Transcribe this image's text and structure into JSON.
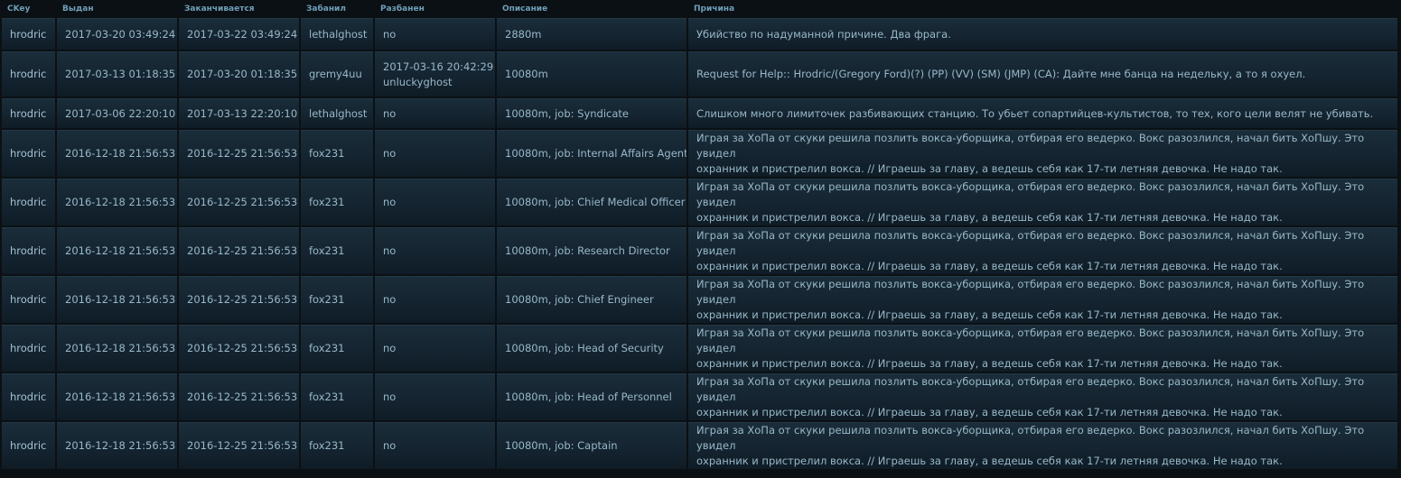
{
  "headers": {
    "ckey": "CKey",
    "issued": "Выдан",
    "expires": "Заканчивается",
    "banned_by": "Забанил",
    "unbanned": "Разбанен",
    "description": "Описание",
    "reason": "Причина"
  },
  "rows": [
    {
      "ckey": "hrodric",
      "issued": "2017-03-20 03:49:24",
      "expires": "2017-03-22 03:49:24",
      "banned_by": "lethalghost",
      "unbanned": "no",
      "unbanned_by": "",
      "description": "2880m",
      "reason_1": "Убийство по надуманной причине. Два фрага.",
      "reason_2": ""
    },
    {
      "ckey": "hrodric",
      "issued": "2017-03-13 01:18:35",
      "expires": "2017-03-20 01:18:35",
      "banned_by": "gremy4uu",
      "unbanned": "2017-03-16 20:42:29",
      "unbanned_by": "unluckyghost",
      "description": "10080m",
      "reason_1": "Request for Help:: Hrodric/(Gregory Ford)(?) (PP) (VV) (SM) (JMP) (CA): Дайте мне банца на недельку, а то я охуел.",
      "reason_2": ""
    },
    {
      "ckey": "hrodric",
      "issued": "2017-03-06 22:20:10",
      "expires": "2017-03-13 22:20:10",
      "banned_by": "lethalghost",
      "unbanned": "no",
      "unbanned_by": "",
      "description": "10080m, job: Syndicate",
      "reason_1": "Слишком много лимиточек разбивающих станцию. То убьет сопартийцев-культистов, то тех, кого цели велят не убивать.",
      "reason_2": ""
    },
    {
      "ckey": "hrodric",
      "issued": "2016-12-18 21:56:53",
      "expires": "2016-12-25 21:56:53",
      "banned_by": "fox231",
      "unbanned": "no",
      "unbanned_by": "",
      "description": "10080m, job: Internal Affairs Agent",
      "reason_1": "Играя за ХоПа от скуки решила позлить вокса-уборщика, отбирая его ведерко. Вокс разозлился, начал бить ХоПшу. Это увидел",
      "reason_2": "охранник и пристрелил вокса. // Играешь за главу, а ведешь себя как 17-ти летняя девочка. Не надо так."
    },
    {
      "ckey": "hrodric",
      "issued": "2016-12-18 21:56:53",
      "expires": "2016-12-25 21:56:53",
      "banned_by": "fox231",
      "unbanned": "no",
      "unbanned_by": "",
      "description": "10080m, job: Chief Medical Officer",
      "reason_1": "Играя за ХоПа от скуки решила позлить вокса-уборщика, отбирая его ведерко. Вокс разозлился, начал бить ХоПшу. Это увидел",
      "reason_2": "охранник и пристрелил вокса. // Играешь за главу, а ведешь себя как 17-ти летняя девочка. Не надо так."
    },
    {
      "ckey": "hrodric",
      "issued": "2016-12-18 21:56:53",
      "expires": "2016-12-25 21:56:53",
      "banned_by": "fox231",
      "unbanned": "no",
      "unbanned_by": "",
      "description": "10080m, job: Research Director",
      "reason_1": "Играя за ХоПа от скуки решила позлить вокса-уборщика, отбирая его ведерко. Вокс разозлился, начал бить ХоПшу. Это увидел",
      "reason_2": "охранник и пристрелил вокса. // Играешь за главу, а ведешь себя как 17-ти летняя девочка. Не надо так."
    },
    {
      "ckey": "hrodric",
      "issued": "2016-12-18 21:56:53",
      "expires": "2016-12-25 21:56:53",
      "banned_by": "fox231",
      "unbanned": "no",
      "unbanned_by": "",
      "description": "10080m, job: Chief Engineer",
      "reason_1": "Играя за ХоПа от скуки решила позлить вокса-уборщика, отбирая его ведерко. Вокс разозлился, начал бить ХоПшу. Это увидел",
      "reason_2": "охранник и пристрелил вокса. // Играешь за главу, а ведешь себя как 17-ти летняя девочка. Не надо так."
    },
    {
      "ckey": "hrodric",
      "issued": "2016-12-18 21:56:53",
      "expires": "2016-12-25 21:56:53",
      "banned_by": "fox231",
      "unbanned": "no",
      "unbanned_by": "",
      "description": "10080m, job: Head of Security",
      "reason_1": "Играя за ХоПа от скуки решила позлить вокса-уборщика, отбирая его ведерко. Вокс разозлился, начал бить ХоПшу. Это увидел",
      "reason_2": "охранник и пристрелил вокса. // Играешь за главу, а ведешь себя как 17-ти летняя девочка. Не надо так."
    },
    {
      "ckey": "hrodric",
      "issued": "2016-12-18 21:56:53",
      "expires": "2016-12-25 21:56:53",
      "banned_by": "fox231",
      "unbanned": "no",
      "unbanned_by": "",
      "description": "10080m, job: Head of Personnel",
      "reason_1": "Играя за ХоПа от скуки решила позлить вокса-уборщика, отбирая его ведерко. Вокс разозлился, начал бить ХоПшу. Это увидел",
      "reason_2": "охранник и пристрелил вокса. // Играешь за главу, а ведешь себя как 17-ти летняя девочка. Не надо так."
    },
    {
      "ckey": "hrodric",
      "issued": "2016-12-18 21:56:53",
      "expires": "2016-12-25 21:56:53",
      "banned_by": "fox231",
      "unbanned": "no",
      "unbanned_by": "",
      "description": "10080m, job: Captain",
      "reason_1": "Играя за ХоПа от скуки решила позлить вокса-уборщика, отбирая его ведерко. Вокс разозлился, начал бить ХоПшу. Это увидел",
      "reason_2": "охранник и пристрелил вокса. // Играешь за главу, а ведешь себя как 17-ти летняя девочка. Не надо так."
    }
  ]
}
